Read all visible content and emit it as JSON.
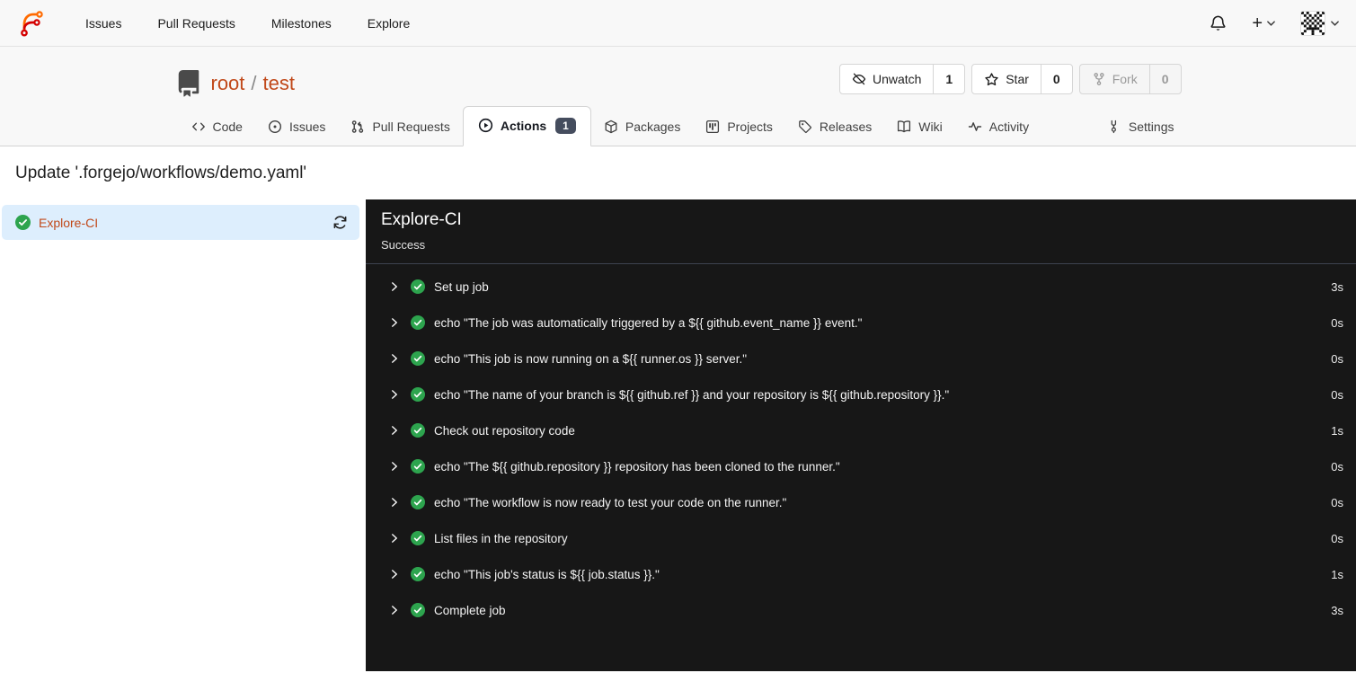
{
  "navbar": {
    "links": [
      {
        "label": "Issues"
      },
      {
        "label": "Pull Requests"
      },
      {
        "label": "Milestones"
      },
      {
        "label": "Explore"
      }
    ]
  },
  "repo_header": {
    "owner": "root",
    "slash": "/",
    "name": "test",
    "buttons": [
      {
        "label": "Unwatch",
        "count": "1"
      },
      {
        "label": "Star",
        "count": "0"
      },
      {
        "label": "Fork",
        "count": "0"
      }
    ]
  },
  "tabs": [
    {
      "label": "Code"
    },
    {
      "label": "Issues"
    },
    {
      "label": "Pull Requests"
    },
    {
      "label": "Actions",
      "badge": "1"
    },
    {
      "label": "Packages"
    },
    {
      "label": "Projects"
    },
    {
      "label": "Releases"
    },
    {
      "label": "Wiki"
    },
    {
      "label": "Activity"
    },
    {
      "label": "Settings"
    }
  ],
  "page": {
    "title": "Update '.forgejo/workflows/demo.yaml'"
  },
  "sidebar": {
    "jobs": [
      {
        "label": "Explore-CI",
        "status": "success"
      }
    ]
  },
  "run_panel": {
    "job_title": "Explore-CI",
    "job_status": "Success",
    "steps": [
      {
        "label": "Set up job",
        "duration": "3s"
      },
      {
        "label": "echo \"The job was automatically triggered by a ${{ github.event_name }} event.\"",
        "duration": "0s"
      },
      {
        "label": "echo \"This job is now running on a ${{ runner.os }} server.\"",
        "duration": "0s"
      },
      {
        "label": "echo \"The name of your branch is ${{ github.ref }} and your repository is ${{ github.repository }}.\"",
        "duration": "0s"
      },
      {
        "label": "Check out repository code",
        "duration": "1s"
      },
      {
        "label": "echo \"The ${{ github.repository }} repository has been cloned to the runner.\"",
        "duration": "0s"
      },
      {
        "label": "echo \"The workflow is now ready to test your code on the runner.\"",
        "duration": "0s"
      },
      {
        "label": "List files in the repository",
        "duration": "0s"
      },
      {
        "label": "echo \"This job's status is ${{ job.status }}.\"",
        "duration": "1s"
      },
      {
        "label": "Complete job",
        "duration": "3s"
      }
    ]
  },
  "colors": {
    "link_accent": "#c1491a",
    "panel_bg": "#171717",
    "success_green": "#2da44e",
    "selected_job_bg": "#ddeefd",
    "badge_bg": "#454d5e",
    "header_bg": "#f8f8f8"
  }
}
